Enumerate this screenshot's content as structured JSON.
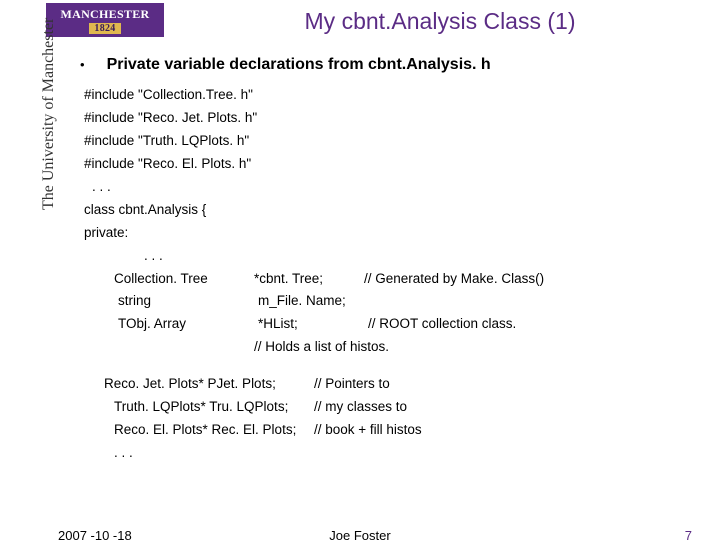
{
  "logo": {
    "institution_name": "MANCHESTER",
    "year": "1824",
    "side_caption": "The University of Manchester"
  },
  "title": "My cbnt.Analysis Class (1)",
  "bullet": "Private variable declarations from cbnt.Analysis. h",
  "code": {
    "includes": [
      "#include \"Collection.Tree. h\"",
      "#include \"Reco. Jet. Plots. h\"",
      "#include \"Truth. LQPlots. h\"",
      "#include \"Reco. El. Plots. h\""
    ],
    "ellipsis1": ". . .",
    "class_decl": "class cbnt.Analysis {",
    "access": "private:",
    "ellipsis2": ". . .",
    "members": [
      {
        "type": "Collection. Tree",
        "name": "*cbnt. Tree;",
        "comment": "// Generated by Make. Class()"
      },
      {
        "type": "string",
        "name": "m_File. Name;",
        "comment": ""
      },
      {
        "type": "TObj. Array",
        "name": "*HList;",
        "comment": "// ROOT collection class."
      }
    ],
    "holds_comment": "// Holds a list of histos.",
    "pointers": [
      {
        "decl": "Reco. Jet. Plots* PJet. Plots;",
        "comment": "//  Pointers to"
      },
      {
        "decl": "Truth. LQPlots* Tru. LQPlots;",
        "comment": "//  my classes to"
      },
      {
        "decl": "Reco. El. Plots* Rec. El. Plots;",
        "comment": "//  book + fill histos"
      }
    ],
    "ellipsis3": ". . ."
  },
  "footer": {
    "date": "2007 -10 -18",
    "author": "Joe Foster",
    "page": "7"
  }
}
